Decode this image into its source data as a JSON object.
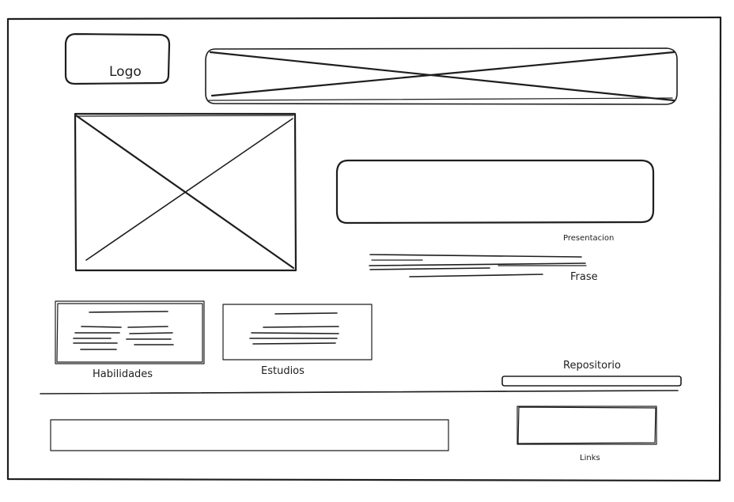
{
  "labels": {
    "logo": "Logo",
    "presentacion": "Presentacion",
    "frase": "Frase",
    "habilidades": "Habilidades",
    "estudios": "Estudios",
    "repositorio": "Repositorio",
    "links": "Links"
  },
  "colors": {
    "stroke": "#1e1e1e",
    "background": "#ffffff"
  }
}
